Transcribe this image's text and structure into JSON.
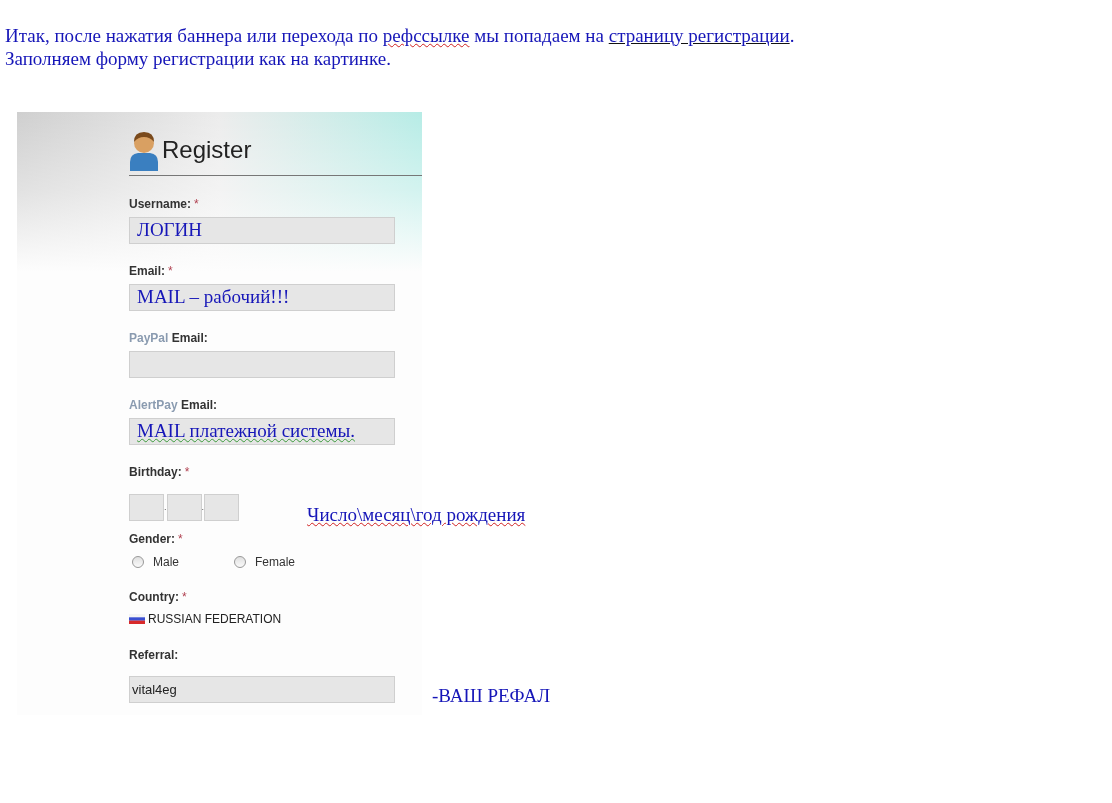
{
  "intro": [
    {
      "segments": [
        {
          "kind": "text",
          "text": "Итак, после нажатия баннера или перехода по "
        },
        {
          "kind": "spell",
          "text": "рефссылке"
        },
        {
          "kind": "text",
          "text": " мы попадаем на "
        },
        {
          "kind": "link",
          "text": "страницу регистрации"
        },
        {
          "kind": "text",
          "text": "."
        }
      ]
    },
    {
      "segments": [
        {
          "kind": "text",
          "text": "Заполняем форму регистрации как на картинке."
        }
      ]
    }
  ],
  "form": {
    "title": "Register",
    "fields": [
      {
        "kind": "text",
        "label": "Username:",
        "required_mark": "*",
        "value": "ЛОГИН",
        "annotated": true
      },
      {
        "kind": "text",
        "label": "Email:",
        "required_mark": "*",
        "value": "MAIL – рабочий!!!",
        "annotated": true
      },
      {
        "kind": "text",
        "label_prefix": "PayPal",
        "label": "Email:"
      },
      {
        "kind": "text",
        "label_prefix": "AlertPay",
        "label": "Email:",
        "value": "MAIL платежной системы.",
        "annotated": true,
        "spell": true
      },
      {
        "kind": "date",
        "label": "Birthday:",
        "required_mark": "*",
        "separators": [
          ".",
          "."
        ],
        "note": "Число\\месяц\\год рождения",
        "note_spell": true
      },
      {
        "kind": "radio",
        "label": "Gender:",
        "required_mark": "*",
        "options": [
          {
            "label": "Male",
            "selected": false
          },
          {
            "label": "Female",
            "selected": false
          }
        ]
      },
      {
        "kind": "country",
        "label": "Country:",
        "required_mark": "*",
        "value": "RUSSIAN FEDERATION"
      },
      {
        "kind": "text",
        "label": "Referral:",
        "value": "vital4eg",
        "annotated": false,
        "note": "-ВАШ РЕФАЛ",
        "note_spell": false
      }
    ]
  }
}
